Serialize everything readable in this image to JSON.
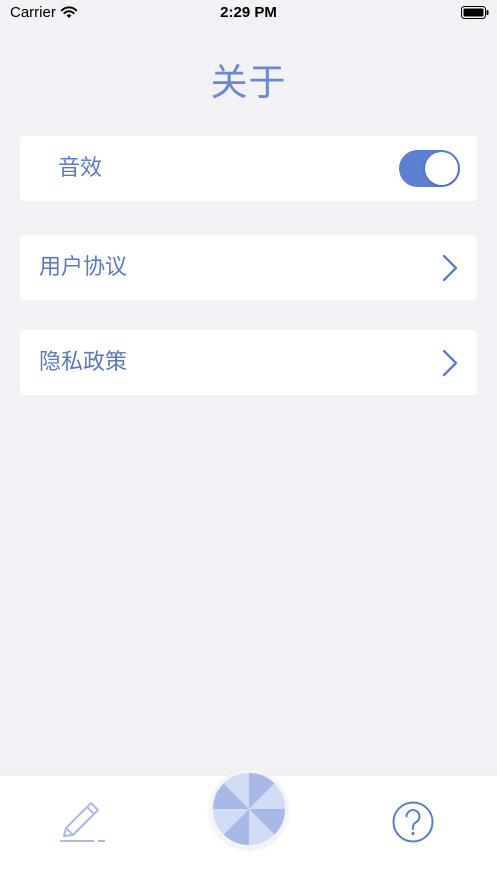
{
  "status_bar": {
    "carrier": "Carrier",
    "time": "2:29 PM"
  },
  "page": {
    "title": "关于"
  },
  "settings": [
    {
      "label": "音效",
      "control": "toggle",
      "value": true
    },
    {
      "label": "用户协议",
      "control": "chevron-right-icon"
    },
    {
      "label": "隐私政策",
      "control": "chevron-right-icon"
    }
  ],
  "tab_bar": {
    "items": [
      {
        "icon": "pencil-icon"
      },
      {
        "icon": "pinwheel-icon"
      },
      {
        "icon": "help-circle-icon"
      }
    ]
  },
  "colors": {
    "accent": "#5c7fd1",
    "text": "#5b78c9",
    "background": "#f2f1f6"
  }
}
